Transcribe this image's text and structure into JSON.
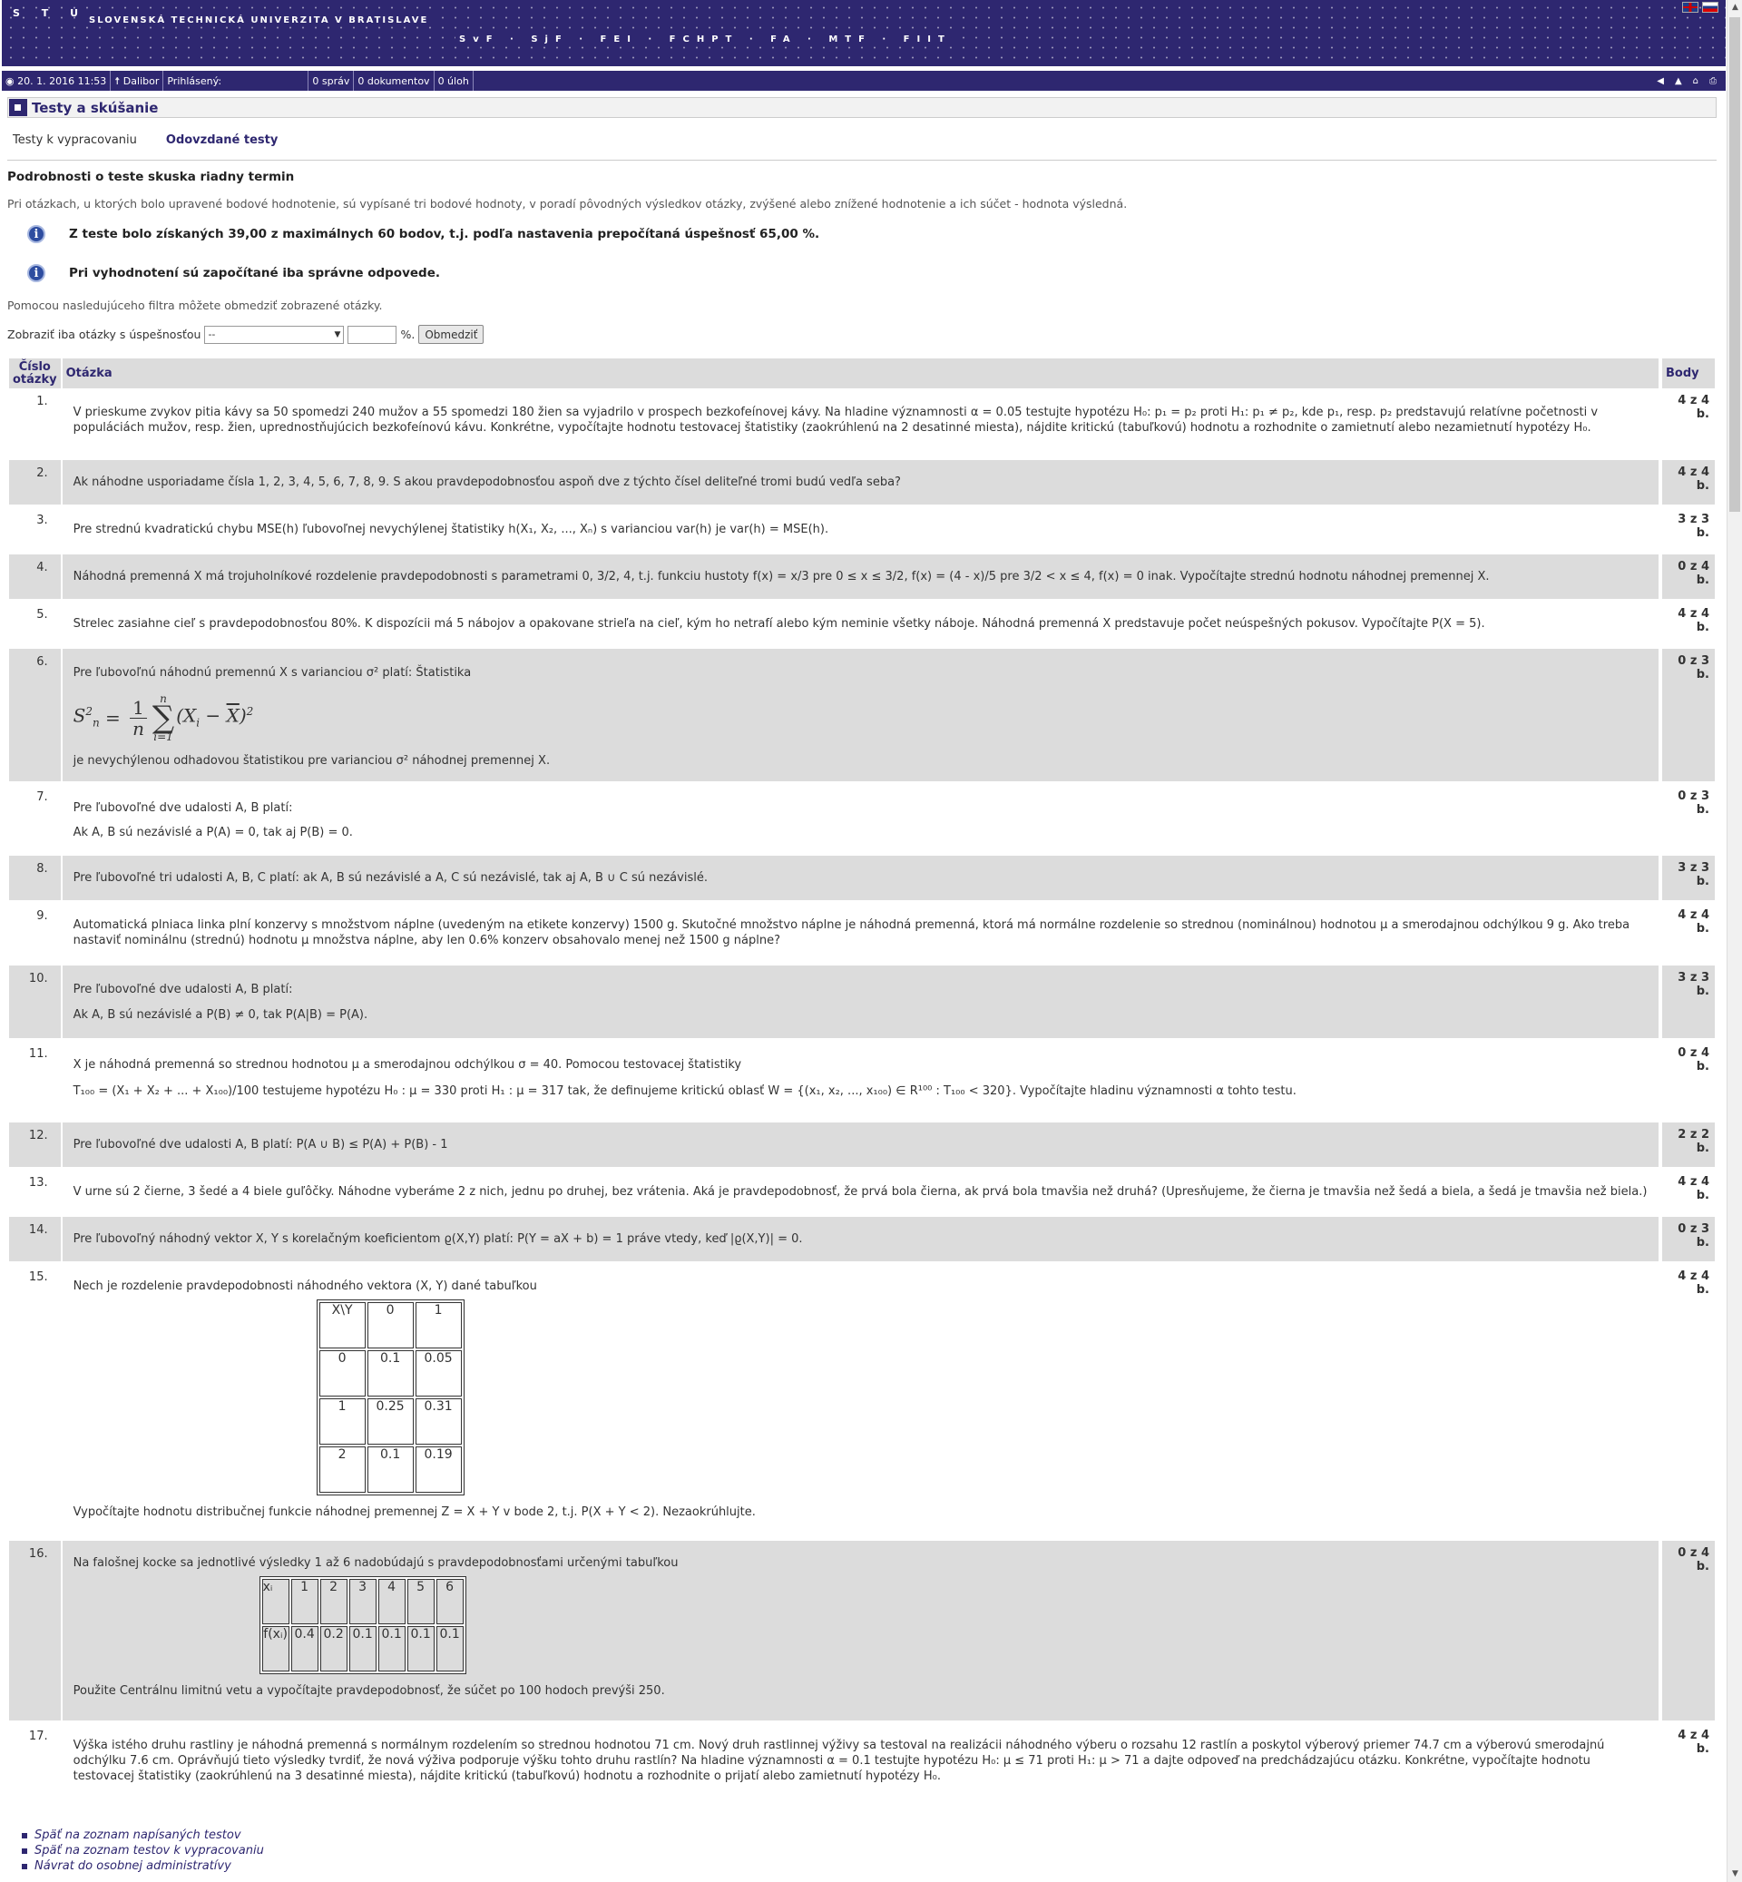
{
  "header": {
    "stu": "S T U",
    "university": "SLOVENSKÁ TECHNICKÁ UNIVERZITA V BRATISLAVE",
    "faculties": "SvF · SjF · FEI · FCHPT · FA · MTF · FIIT"
  },
  "infobar": {
    "datetime": "20. 1. 2016  11:53",
    "user": "Dalibor",
    "logged": "Prihlásený:",
    "messages": "0 správ",
    "documents": "0 dokumentov",
    "tasks": "0 úloh"
  },
  "section_title": "Testy a skúšanie",
  "tabs": [
    "Testy k vypracovaniu",
    "Odovzdané testy"
  ],
  "details": {
    "heading": "Podrobnosti o teste skuska riadny termin",
    "description": "Pri otázkach, u ktorých bolo upravené bodové hodnotenie, sú vypísané tri bodové hodnoty, v poradí pôvodných výsledkov otázky, zvýšené alebo znížené hodnotenie a ich súčet - hodnota výsledná.",
    "info1": "Z teste bolo získaných 39,00 z maximálnych 60 bodov, t.j. podľa nastavenia prepočítaná úspešnosť 65,00 %.",
    "info2": "Pri vyhodnotení sú započítané iba správne odpovede."
  },
  "filter": {
    "note": "Pomocou nasledujúceho filtra môžete obmedziť zobrazené otázky.",
    "label": "Zobraziť iba otázky s úspešnosťou",
    "select_value": "--",
    "percent": "%.",
    "button": "Obmedziť"
  },
  "table_headers": {
    "num": "Číslo otázky",
    "question": "Otázka",
    "points": "Body"
  },
  "questions": [
    {
      "num": "1.",
      "points": "4 z 4 b.",
      "text": "V prieskume zvykov pitia kávy sa 50 spomedzi 240 mužov a 55 spomedzi 180 žien sa vyjadrilo v prospech bezkofeínovej kávy. Na hladine významnosti  α = 0.05  testujte hypotézu  H₀: p₁ = p₂  proti  H₁:  p₁ ≠ p₂, kde  p₁, resp. p₂  predstavujú relatívne početnosti v populáciách mužov, resp. žien, uprednostňujúcich bezkofeínovú kávu. Konkrétne, vypočítajte hodnotu testovacej štatistiky (zaokrúhlenú na 2 desatinné miesta), nájdite kritickú (tabuľkovú) hodnotu a rozhodnite o zamietnutí alebo nezamietnutí hypotézy  H₀."
    },
    {
      "num": "2.",
      "points": "4 z 4 b.",
      "text": "Ak náhodne usporiadame čísla  1, 2, 3, 4, 5, 6, 7, 8, 9. S akou pravdepodobnosťou aspoň dve z týchto čísel deliteľné tromi budú vedľa seba?"
    },
    {
      "num": "3.",
      "points": "3 z 3 b.",
      "text": "Pre strednú kvadratickú chybu  MSE(h)  ľubovoľnej nevychýlenej štatistiky  h(X₁, X₂, ..., Xₙ)  s varianciou  var(h)  je  var(h) = MSE(h)."
    },
    {
      "num": "4.",
      "points": "0 z 4 b.",
      "text": "Náhodná premenná X má trojuholníkové rozdelenie pravdepodobnosti s parametrami 0, 3/2, 4, t.j. funkciu hustoty  f(x) = x/3  pre  0 ≤ x ≤ 3/2,                   f(x) = (4 - x)/5  pre  3/2 < x ≤ 4,  f(x) = 0  inak. Vypočítajte  strednú hodnotu náhodnej premennej  X."
    },
    {
      "num": "5.",
      "points": "4 z 4 b.",
      "text": "Strelec zasiahne cieľ s pravdepodobnosťou 80%. K dispozícii má 5 nábojov a opakovane strieľa na cieľ, kým ho netrafí alebo kým neminie všetky náboje.  Náhodná premenná X predstavuje počet neúspešných pokusov. Vypočítajte  P(X = 5)."
    },
    {
      "num": "6.",
      "points": "0 z 3 b.",
      "text": "Pre ľubovoľnú náhodnú premennú  X  s varianciou  σ²  platí: Štatistika",
      "text2": "je nevychýlenou odhadovou štatistikou pre varianciou  σ²  náhodnej premennej  X."
    },
    {
      "num": "7.",
      "points": "0 z 3 b.",
      "text": "Pre ľubovoľné dve udalosti  A, B  platí:",
      "text2": "Ak A, B  sú nezávislé a  P(A) = 0, tak aj  P(B) = 0."
    },
    {
      "num": "8.",
      "points": "3 z 3 b.",
      "text": "Pre ľubovoľné tri udalosti  A, B, C  platí:  ak  A, B  sú nezávislé a  A, C  sú nezávislé, tak aj  A, B ∪ C sú nezávislé."
    },
    {
      "num": "9.",
      "points": "4 z 4 b.",
      "text": "Automatická plniaca linka plní konzervy s množstvom náplne (uvedeným na etikete konzervy) 1500 g. Skutočné množstvo náplne je náhodná premenná, ktorá má normálne rozdelenie so strednou (nominálnou) hodnotou μ a smerodajnou odchýlkou 9 g. Ako treba nastaviť nominálnu (strednú) hodnotu  μ množstva náplne, aby len 0.6% konzerv obsahovalo menej než 1500 g náplne?"
    },
    {
      "num": "10.",
      "points": "3 z 3 b.",
      "text": "Pre ľubovoľné dve udalosti  A, B  platí:",
      "text2": "Ak A, B  sú nezávislé a  P(B) ≠ 0, tak  P(A|B) = P(A)."
    },
    {
      "num": "11.",
      "points": "0 z 4 b.",
      "text": "X  je náhodná premenná so strednou hodnotou  μ  a smerodajnou odchýlkou  σ  = 40. Pomocou testovacej štatistiky",
      "text2": "T₁₀₀  = (X₁ + X₂ + ... + X₁₀₀)/100  testujeme hypotézu  H₀ : μ = 330  proti  H₁ :  μ =  317  tak, že definujeme kritickú oblasť  W = {(x₁, x₂, ..., x₁₀₀) ∈ R¹⁰⁰ : T₁₀₀ < 320}. Vypočítajte hladinu významnosti  α  tohto testu."
    },
    {
      "num": "12.",
      "points": "2 z 2 b.",
      "text": "Pre ľubovoľné dve udalosti  A, B  platí:  P(A ∪ B) ≤ P(A) + P(B) - 1"
    },
    {
      "num": "13.",
      "points": "4 z 4 b.",
      "text": "V urne sú  2  čierne, 3  šedé a  4  biele guľôčky. Náhodne vyberáme  2  z nich, jednu po druhej, bez vrátenia. Aká je pravdepodobnosť, že prvá bola čierna, ak prvá bola tmavšia než druhá? (Upresňujeme, že čierna je tmavšia než šedá a biela, a šedá je tmavšia než biela.)"
    },
    {
      "num": "14.",
      "points": "0 z 3 b.",
      "text": "Pre ľubovoľný náhodný vektor  X, Y  s korelačným koeficientom  ϱ(X,Y)  platí: P(Y = aX + b) = 1  práve vtedy, keď  |ϱ(X,Y)| = 0."
    },
    {
      "num": "15.",
      "points": "4 z 4 b.",
      "text": "Nech je rozdelenie pravdepodobnosti náhodného vektora  (X, Y)  dané tabuľkou",
      "table": [
        [
          "X\\Y",
          "0",
          "1"
        ],
        [
          "0",
          "0.1",
          "0.05"
        ],
        [
          "1",
          "0.25",
          "0.31"
        ],
        [
          "2",
          "0.1",
          "0.19"
        ]
      ],
      "text2": "Vypočítajte hodnotu distribučnej funkcie náhodnej premennej  Z = X + Y  v bode  2, t.j. P(X + Y < 2). Nezaokrúhlujte."
    },
    {
      "num": "16.",
      "points": "0 z 4 b.",
      "text": "Na falošnej kocke sa jednotlivé výsledky  1  až  6  nadobúdajú s pravdepodobnosťami určenými tabuľkou",
      "table": [
        [
          "xᵢ",
          "1",
          "2",
          "3",
          "4",
          "5",
          "6"
        ],
        [
          "f(xᵢ)",
          "0.4",
          "0.2",
          "0.1",
          "0.1",
          "0.1",
          "0.1"
        ]
      ],
      "text2": "Použite Centrálnu limitnú vetu a vypočítajte pravdepodobnosť, že súčet po  100  hodoch prevýši  250."
    },
    {
      "num": "17.",
      "points": "4 z 4 b.",
      "text": "Výška istého druhu rastliny je náhodná premenná s normálnym rozdelením so strednou hodnotou  71  cm. Nový druh rastlinnej výživy sa testoval na realizácii náhodného výberu o rozsahu  12  rastlín a poskytol výberový priemer  74.7 cm a výberovú smerodajnú odchýlku  7.6 cm. Oprávňujú tieto výsledky tvrdiť, že nová výživa podporuje výšku tohto druhu rastlín? Na hladine významnosti  α = 0.1  testujte hypotézu  H₀: μ ≤ 71  proti  H₁: μ > 71  a dajte odpoveď na predchádzajúcu otázku. Konkrétne, vypočítajte hodnotu testovacej štatistiky (zaokrúhlenú na 3 desatinné miesta), nájdite kritickú (tabuľkovú) hodnotu a rozhodnite o prijatí alebo zamietnutí  hypotézy  H₀."
    }
  ],
  "footer": {
    "links": [
      "Späť na zoznam napísaných testov",
      "Späť na zoznam testov k vypracovaniu",
      "Návrat do osobnej administratívy"
    ]
  }
}
